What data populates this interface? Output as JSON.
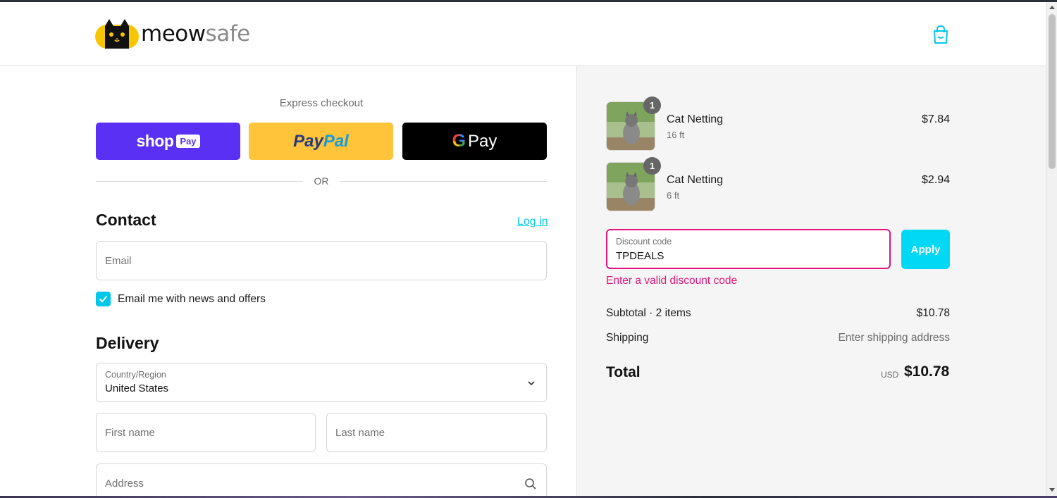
{
  "brand": {
    "name_part1": "meow",
    "name_part2": "safe",
    "logo_icon": "cat-face-icon"
  },
  "header": {
    "cart_icon": "shopping-bag-icon"
  },
  "express": {
    "title": "Express checkout",
    "shop_pay": {
      "word": "shop",
      "badge": "Pay"
    },
    "paypal": {
      "part1": "Pay",
      "part2": "Pal"
    },
    "gpay": {
      "g": "G",
      "word": "Pay"
    },
    "or_label": "OR"
  },
  "contact": {
    "title": "Contact",
    "login_link": "Log in",
    "email_placeholder": "Email",
    "newsletter_label": "Email me with news and offers",
    "newsletter_checked": true
  },
  "delivery": {
    "title": "Delivery",
    "country_label": "Country/Region",
    "country_value": "United States",
    "first_name_placeholder": "First name",
    "last_name_placeholder": "Last name",
    "address_placeholder": "Address"
  },
  "order": {
    "items": [
      {
        "name": "Cat Netting",
        "variant": "16 ft",
        "price": "$7.84",
        "quantity": "1"
      },
      {
        "name": "Cat Netting",
        "variant": "6 ft",
        "price": "$2.94",
        "quantity": "1"
      }
    ],
    "discount": {
      "label": "Discount code",
      "value": "TPDEALS",
      "apply_label": "Apply",
      "error": "Enter a valid discount code"
    },
    "subtotal_label": "Subtotal · 2 items",
    "subtotal_value": "$10.78",
    "shipping_label": "Shipping",
    "shipping_value": "Enter shipping address",
    "total_label": "Total",
    "total_currency": "USD",
    "total_value": "$10.78"
  },
  "colors": {
    "accent": "#00c8e8",
    "error": "#e0167a",
    "shop_pay": "#5a31f4",
    "paypal": "#ffc439"
  }
}
